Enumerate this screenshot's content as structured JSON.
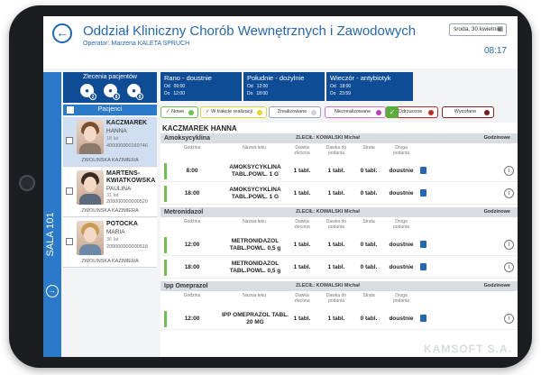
{
  "header": {
    "title": "Oddział Kliniczny Chorób Wewnętrznych i Zawodowych",
    "operator": "Operator: Marzena KALETA SPRUCH",
    "date": "środa, 30 kwietnia",
    "time": "08:17"
  },
  "sidebar": {
    "orders_label": "Zlecenia pacjentów",
    "order_counts": [
      "2",
      "8",
      "8"
    ],
    "patients_label": "Pacjenci",
    "sala_label": "SALA 101",
    "patients": [
      {
        "last": "KACZMAREK",
        "first": "HANNA",
        "age": "18 lat",
        "id": "400000000169746",
        "doctor": "ZWOLINSKA KAZIMIERA",
        "selected": true
      },
      {
        "last": "MARTENS-KWIATKOWSKA",
        "last1": "MARTENS-",
        "last2": "KWIATKOWSKA",
        "first": "PAULINA",
        "age": "31 lat",
        "id": "200000000000520",
        "doctor": "ZWOLINSKA KAZIMIERA",
        "selected": false
      },
      {
        "last": "POTOCKA",
        "first": "MARIA",
        "age": "36 lat",
        "id": "200000000000518",
        "doctor": "ZWOLINSKA KAZIMIERA",
        "selected": false
      }
    ]
  },
  "schedule": [
    {
      "title": "Rano - doustnie",
      "od_label": "Od",
      "od": "00:00",
      "do_label": "Do",
      "do": "12:00"
    },
    {
      "title": "Południe - dożylnie",
      "od_label": "Od",
      "od": "12:00",
      "do_label": "Do",
      "do": "18:00"
    },
    {
      "title": "Wieczór - antybiotyk",
      "od_label": "Od",
      "od": "18:00",
      "do_label": "Do",
      "do": "23:59"
    }
  ],
  "statuses": [
    {
      "label": "Nowe",
      "checked": true,
      "border": "#6fc24a",
      "dot": "#6fc24a"
    },
    {
      "label": "W trakcie realizacji",
      "checked": true,
      "border": "#e6d62c",
      "dot": "#e6d62c"
    },
    {
      "label": "Zrealizowane",
      "checked": false,
      "border": "#9aa5b3",
      "dot": "#cfd4da"
    },
    {
      "label": "Niezrealizowane",
      "checked": false,
      "border": "#d66fc4",
      "dot": "#c23fb0"
    },
    {
      "label": "Odrzucone",
      "checked": false,
      "border": "#c62828",
      "dot": "#c62828"
    },
    {
      "label": "Wycofane",
      "checked": false,
      "border": "#8e1f1f",
      "dot": "#7b1a1a"
    }
  ],
  "main": {
    "patient_name": "KACZMAREK HANNA",
    "columns": {
      "godzina": "Godzina",
      "nazwa": "Nazwa leku",
      "dawka_zlecona1": "Dawka",
      "dawka_zlecona2": "zlecona",
      "dawka_podania1": "Dawka do",
      "dawka_podania2": "podania",
      "strata": "Strata",
      "droga1": "Droga",
      "droga2": "podania",
      "godzinowe": "Godzinowe"
    },
    "drugs": [
      {
        "name": "Amoksycyklina",
        "zlecil": "ZLECIŁ: KOWALSKI Michał",
        "show_godzinowe": true,
        "rows": [
          {
            "time": "8:00",
            "med1": "AMOKSYCYKLINA",
            "med2": "TABL.POWL. 1 G",
            "dose": "1 tabl.",
            "dose_give": "1 tabl.",
            "loss": "0 tabl.",
            "route": "doustnie"
          },
          {
            "time": "18:00",
            "med1": "AMOKSYCYKLINA",
            "med2": "TABL.POWL. 1 G",
            "dose": "1 tabl.",
            "dose_give": "1 tabl.",
            "loss": "0 tabl.",
            "route": "doustnie"
          }
        ]
      },
      {
        "name": "Metronidazol",
        "zlecil": "ZLECIŁ: KOWALSKI Michał",
        "show_godzinowe": true,
        "rows": [
          {
            "time": "12:00",
            "med1": "METRONIDAZOL",
            "med2": "TABL.POWL. 0,5 g",
            "dose": "1 tabl.",
            "dose_give": "1 tabl.",
            "loss": "0 tabl.",
            "route": "doustnie"
          },
          {
            "time": "18:00",
            "med1": "METRONIDAZOL",
            "med2": "TABL.POWL. 0,5 g",
            "dose": "1 tabl.",
            "dose_give": "1 tabl.",
            "loss": "0 tabl.",
            "route": "doustnie"
          }
        ]
      },
      {
        "name": "Ipp Omeprazol",
        "zlecil": "ZLECIŁ: KOWALSKI Michał",
        "show_godzinowe": true,
        "rows": [
          {
            "time": "12:00",
            "med1": "IPP OMEPRAZOL TABL.",
            "med2": "20 MG",
            "dose": "1 tabl.",
            "dose_give": "1 tabl.",
            "loss": "0 tabl.",
            "route": "doustnie"
          }
        ]
      }
    ],
    "approve_icon": "check-icon",
    "watermark": "KAMSOFT S.A."
  },
  "icons": {
    "back": "arrow-left-icon",
    "calendar": "calendar-icon",
    "route": "document-icon",
    "info": "info-icon",
    "sala": "arrow-right-circle-icon"
  }
}
